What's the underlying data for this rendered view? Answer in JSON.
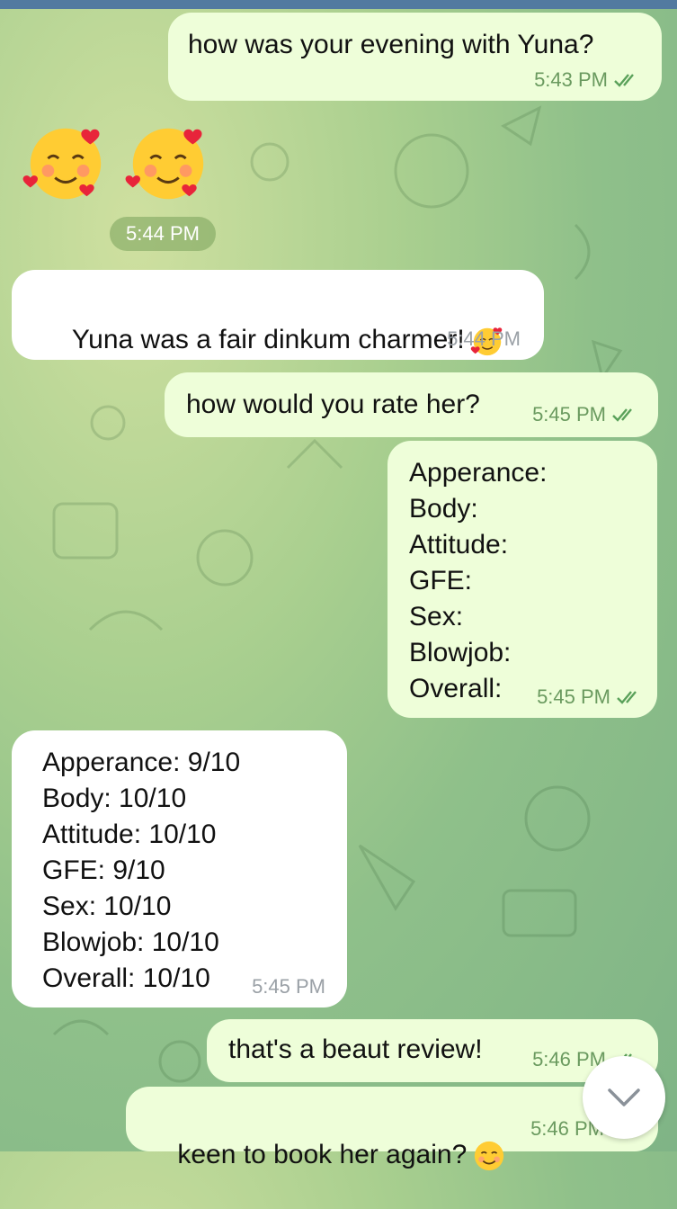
{
  "chat": {
    "messages": [
      {
        "dir": "out",
        "text": "how was your evening with Yuna?",
        "time": "5:43 PM"
      },
      {
        "dir": "in",
        "type": "stickers",
        "stickers": [
          "smiling-face-with-hearts",
          "smiling-face-with-hearts"
        ],
        "time": "5:44 PM"
      },
      {
        "dir": "in",
        "text": "Yuna was a fair dinkum charmer!",
        "emoji": "smiling-face-with-hearts",
        "time": "5:44 PM"
      },
      {
        "dir": "out",
        "text": "how would you rate her?",
        "time": "5:45 PM"
      },
      {
        "dir": "out",
        "lines": [
          "Apperance:",
          "Body:",
          "Attitude:",
          "GFE:",
          "Sex:",
          "Blowjob:",
          "Overall:"
        ],
        "time": "5:45 PM"
      },
      {
        "dir": "in",
        "lines": [
          "Apperance: 9/10",
          "Body: 10/10",
          "Attitude: 10/10",
          "GFE: 9/10",
          "Sex: 10/10",
          "Blowjob: 10/10",
          "Overall: 10/10"
        ],
        "time": "5:45 PM"
      },
      {
        "dir": "out",
        "text": "that's a beaut review!",
        "time": "5:46 PM"
      },
      {
        "dir": "out",
        "text": "keen to book her again?",
        "emoji": "smiling-face-with-smiling-eyes",
        "time": "5:46 PM"
      }
    ]
  },
  "icons": {
    "read_ticks": "double-check-icon",
    "scroll_down": "chevron-down-icon"
  },
  "colors": {
    "outgoing_bubble": "#eefed9",
    "incoming_bubble": "#ffffff",
    "outgoing_meta": "#6a9a5f",
    "incoming_meta": "#9aa0a6",
    "top_bar": "#527aa0"
  }
}
